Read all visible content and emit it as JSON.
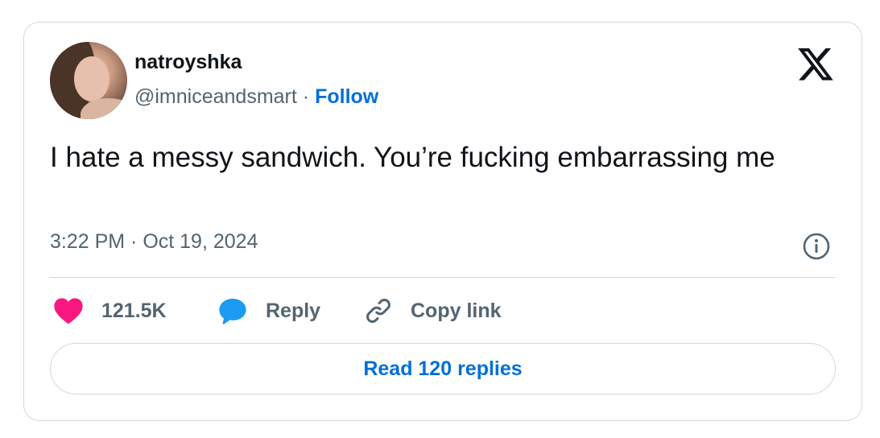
{
  "author": {
    "display_name": "natroyshka",
    "handle": "@imniceandsmart",
    "separator": "·",
    "follow_label": "Follow"
  },
  "tweet": {
    "text": "I hate a messy sandwich. You’re fucking embarrassing me",
    "timestamp": "3:22 PM · Oct 19, 2024"
  },
  "actions": {
    "likes_count": "121.5K",
    "reply_label": "Reply",
    "copy_link_label": "Copy link",
    "read_replies_label": "Read 120 replies"
  },
  "icons": {
    "logo": "x-logo-icon",
    "info": "info-icon",
    "like": "heart-icon",
    "reply": "speech-bubble-icon",
    "copy": "link-icon"
  },
  "colors": {
    "accent": "#006fd6",
    "heart": "#f91880",
    "reply_bubble": "#1d9bf0",
    "secondary_text": "#536471",
    "border": "#cfd9de"
  }
}
